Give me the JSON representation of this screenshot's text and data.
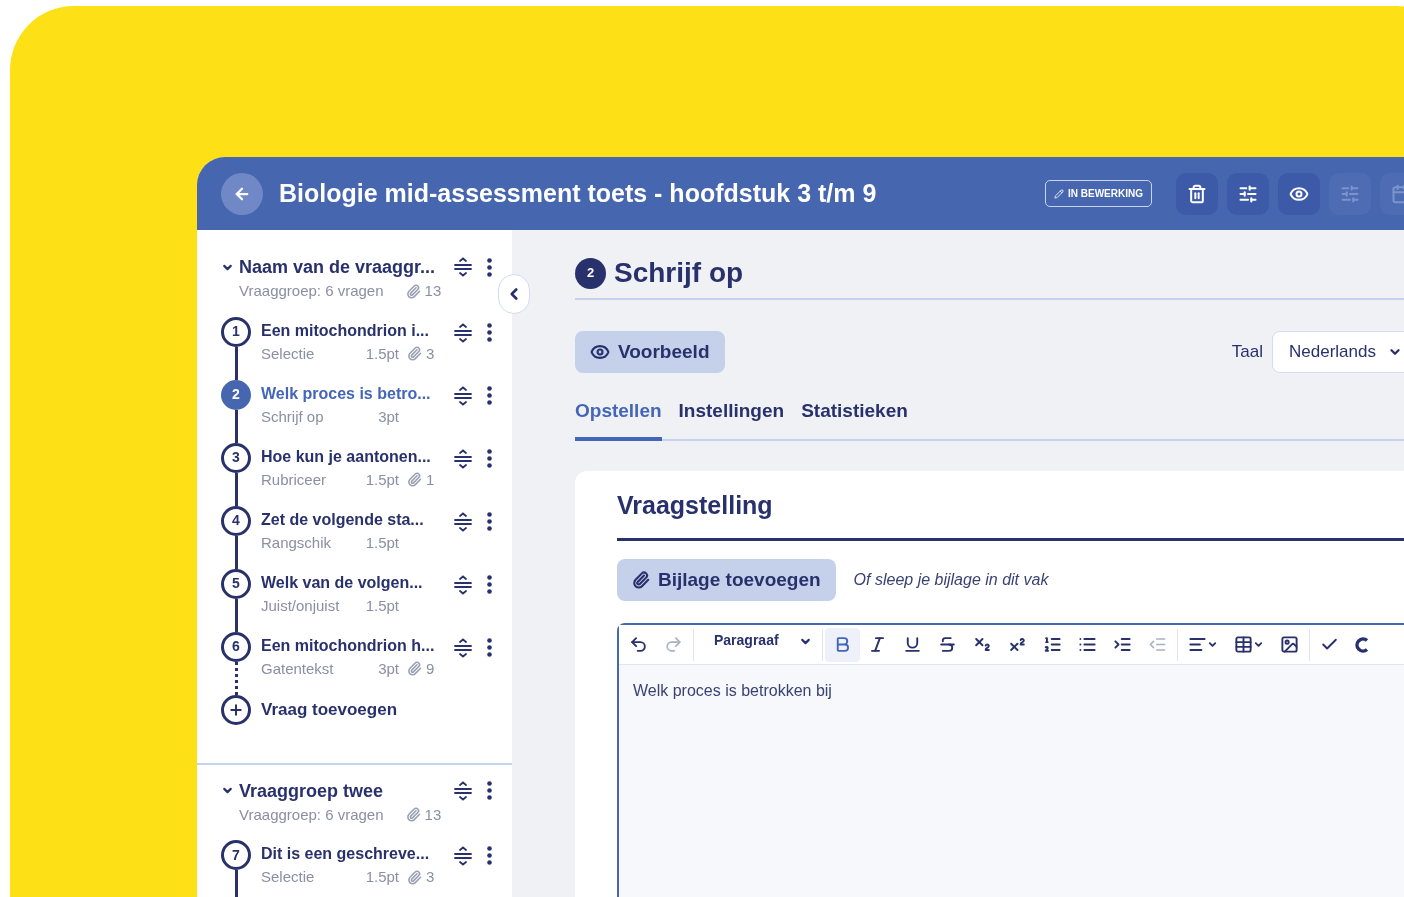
{
  "header": {
    "title": "Biologie mid-assessment toets - hoofdstuk 3 t/m 9",
    "status_badge": "IN BEWERKING",
    "toolbar_buttons": [
      {
        "kind": "delete",
        "disabled": false
      },
      {
        "kind": "settings",
        "disabled": false
      },
      {
        "kind": "preview",
        "disabled": false
      },
      {
        "kind": "settings",
        "disabled": true
      },
      {
        "kind": "calendar",
        "disabled": true
      }
    ]
  },
  "sidebar": {
    "groups": [
      {
        "title": "Naam van de vraaggr...",
        "subtitle": "Vraaggroep: 6 vragen",
        "attachments": "13",
        "expanded": true,
        "add_label": "Vraag toevoegen",
        "questions": [
          {
            "number": "1",
            "title": "Een mitochondrion i...",
            "type": "Selectie",
            "points": "1.5pt",
            "attachments": "3",
            "selected": false
          },
          {
            "number": "2",
            "title": "Welk proces is betro...",
            "type": "Schrijf op",
            "points": "3pt",
            "selected": true
          },
          {
            "number": "3",
            "title": "Hoe kun je aantonen...",
            "type": "Rubriceer",
            "points": "1.5pt",
            "attachments": "1",
            "selected": false
          },
          {
            "number": "4",
            "title": "Zet de volgende sta...",
            "type": "Rangschik",
            "points": "1.5pt",
            "selected": false
          },
          {
            "number": "5",
            "title": "Welk van de volgen...",
            "type": "Juist/onjuist",
            "points": "1.5pt",
            "selected": false
          },
          {
            "number": "6",
            "title": "Een mitochondrion h...",
            "type": "Gatentekst",
            "points": "3pt",
            "attachments": "9",
            "selected": false
          }
        ]
      },
      {
        "title": "Vraaggroep twee",
        "subtitle": "Vraaggroep: 6 vragen",
        "attachments": "13",
        "expanded": true,
        "questions": [
          {
            "number": "7",
            "title": "Dit is een geschreve...",
            "type": "Selectie",
            "points": "1.5pt",
            "attachments": "3",
            "selected": false
          }
        ]
      }
    ]
  },
  "main": {
    "question_number": "2",
    "heading": "Schrijf op",
    "preview_button": "Voorbeeld",
    "language_label": "Taal",
    "language_value": "Nederlands",
    "tabs": [
      {
        "label": "Opstellen",
        "selected": true
      },
      {
        "label": "Instellingen",
        "selected": false
      },
      {
        "label": "Statistieken",
        "selected": false
      }
    ],
    "panel": {
      "title": "Vraagstelling",
      "attach_button": "Bijlage toevoegen",
      "drop_hint": "Of sleep je bijlage in dit vak",
      "editor": {
        "format": "Paragraaf",
        "content": "Welk proces is betrokken bij",
        "history_tools": [
          {
            "kind": "undo",
            "active": false,
            "disabled": false
          },
          {
            "kind": "redo",
            "active": false,
            "disabled": true
          }
        ],
        "tools": [
          {
            "kind": "bold",
            "active": true,
            "disabled": false
          },
          {
            "kind": "italic",
            "active": false,
            "disabled": false
          },
          {
            "kind": "underline",
            "active": false,
            "disabled": false
          },
          {
            "kind": "strike",
            "active": false,
            "disabled": false
          },
          {
            "kind": "subscript",
            "active": false,
            "disabled": false
          },
          {
            "kind": "superscript",
            "active": false,
            "disabled": false
          },
          {
            "kind": "ordered-list",
            "active": false,
            "disabled": false
          },
          {
            "kind": "bullet-list",
            "active": false,
            "disabled": false
          },
          {
            "kind": "indent",
            "active": false,
            "disabled": false
          },
          {
            "kind": "outdent",
            "active": false,
            "disabled": true
          }
        ],
        "insert_tools": [
          {
            "kind": "align",
            "active": false,
            "disabled": false
          },
          {
            "kind": "table",
            "active": false,
            "disabled": false
          },
          {
            "kind": "image",
            "active": false,
            "disabled": false
          }
        ],
        "extra_tools": [
          {
            "kind": "check",
            "disabled": false
          },
          {
            "kind": "c-tool",
            "disabled": false
          }
        ]
      }
    }
  }
}
